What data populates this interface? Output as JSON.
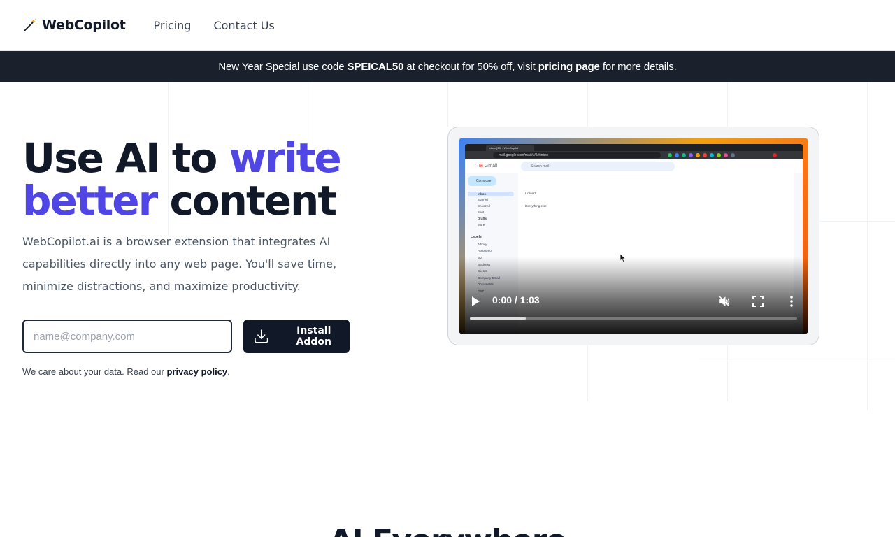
{
  "header": {
    "logo_text": "WebCopilot",
    "nav": [
      {
        "label": "Pricing"
      },
      {
        "label": "Contact Us"
      }
    ]
  },
  "banner": {
    "text_before": "New Year Special use code ",
    "code": "SPEICAL50",
    "text_middle": " at checkout for 50% off, visit ",
    "link": "pricing page",
    "text_after": " for more details."
  },
  "hero": {
    "title_part1": "Use AI to ",
    "title_accent1": "write",
    "title_accent2": "better",
    "title_part2": " content",
    "description": "WebCopilot.ai is a browser extension that integrates AI capabilities directly into any web page. You'll save time, minimize distractions, and maximize productivity.",
    "email_placeholder": "name@company.com",
    "email_value": "",
    "install_label": "Install Addon",
    "privacy_text": "We care about your data. Read our ",
    "privacy_link": "privacy policy",
    "privacy_end": "."
  },
  "video": {
    "time": "0:00 / 1:03",
    "progress_buffered": 0.17,
    "muted": true,
    "gmail": {
      "app_name": "Gmail",
      "search_placeholder": "Search mail",
      "url": "mail.google.com/mail/u/0/#inbox",
      "tab_title": "Inbox (38) - WebCopilot",
      "compose": "Compose",
      "nav": [
        "Inbox",
        "Starred",
        "Snoozed",
        "Sent",
        "Drafts",
        "More"
      ],
      "labels_heading": "Labels",
      "labels": [
        "Affinity",
        "AppSumo",
        "Biz",
        "Business",
        "Clients",
        "Company Email",
        "Documents",
        "GST"
      ],
      "rows": [
        "Unread",
        "Everything else"
      ]
    }
  },
  "section": {
    "title": "AI Everywhere"
  },
  "colors": {
    "accent": "#4f46e5",
    "banner_bg": "#1a202c",
    "button_bg": "#111827"
  },
  "icons": {
    "logo": "magic-wand-icon",
    "install": "download-icon",
    "play": "play-icon",
    "mute": "volume-muted-icon",
    "fullscreen": "fullscreen-icon",
    "more": "more-vertical-icon"
  }
}
